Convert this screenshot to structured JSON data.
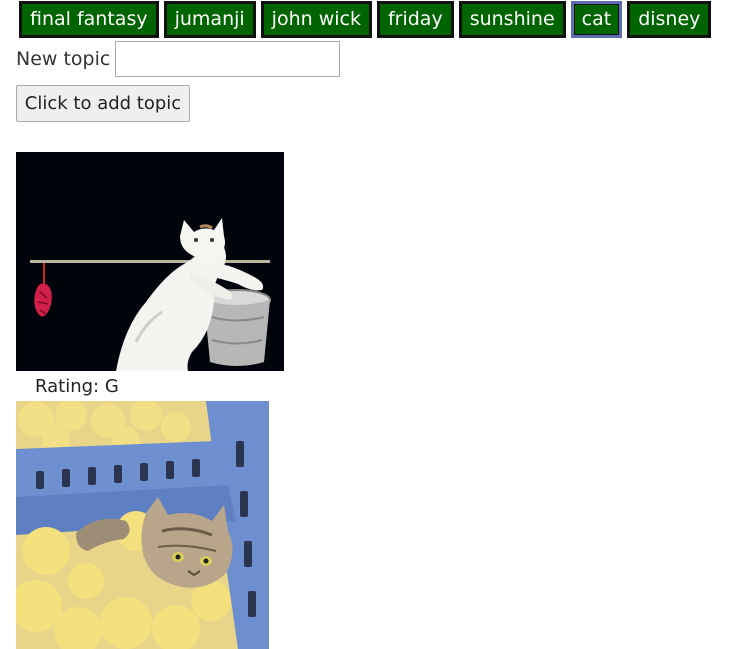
{
  "topics": [
    {
      "label": "final fantasy"
    },
    {
      "label": "jumanji"
    },
    {
      "label": "john wick"
    },
    {
      "label": "friday"
    },
    {
      "label": "sunshine"
    },
    {
      "label": "cat"
    },
    {
      "label": "disney"
    }
  ],
  "form": {
    "new_topic_label": "New topic",
    "new_topic_value": "",
    "add_button_label": "Click to add topic"
  },
  "results": [
    {
      "rating_text": "Rating: G",
      "image": "cat-swatting-toy-gif"
    },
    {
      "image": "cat-among-chicks-gif"
    }
  ],
  "colors": {
    "topic_button_bg": "#006400",
    "topic_button_text": "#ffffff",
    "topic_button_border": "#111111",
    "active_topic_border": "#5b6fb0",
    "add_button_bg": "#efefef"
  },
  "active_topic": "cat"
}
